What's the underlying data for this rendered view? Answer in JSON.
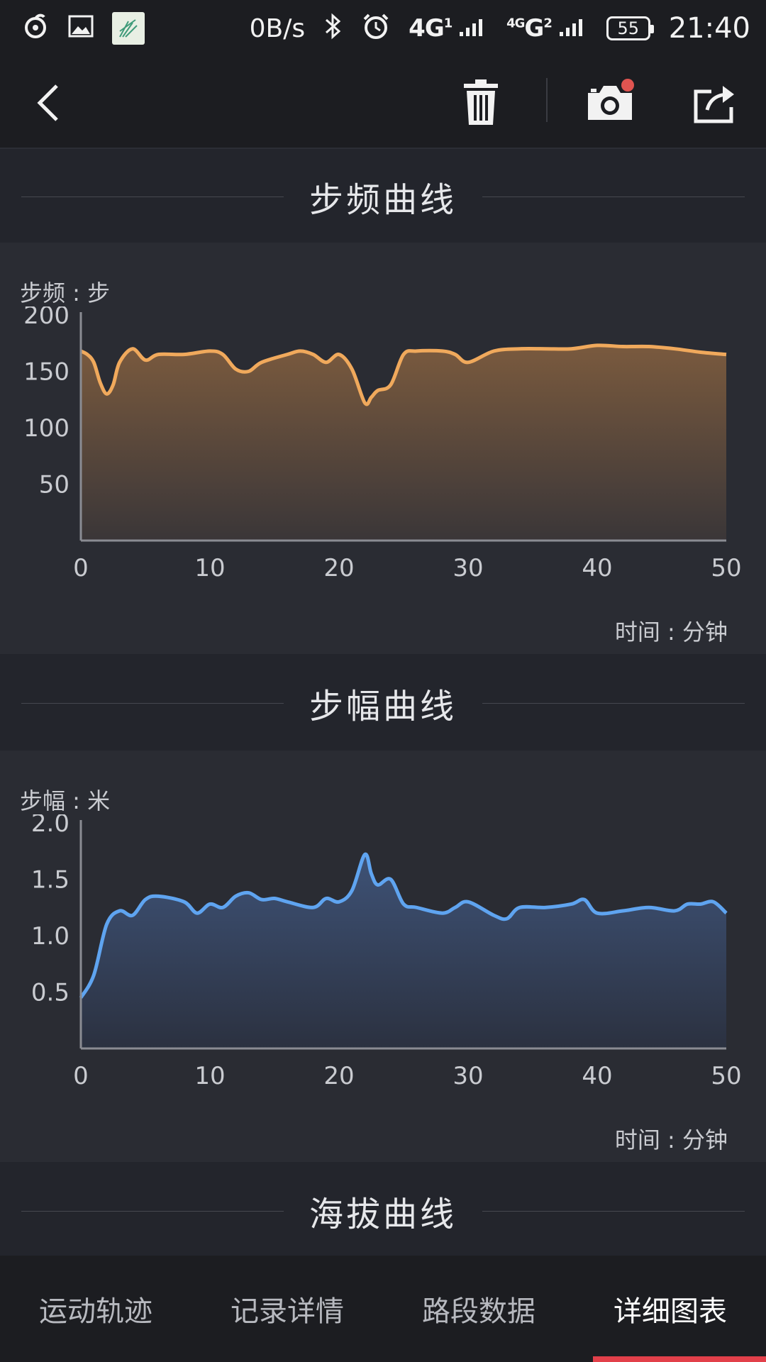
{
  "status_bar": {
    "net_speed": "0B/s",
    "signal1": "4G",
    "signal2": "4G",
    "signal2_letter": "G",
    "sim1": "1",
    "sim2": "2",
    "battery": "55",
    "time": "21:40"
  },
  "toolbar": {
    "back": "back-icon",
    "delete": "trash-icon",
    "camera": "camera-icon",
    "share": "share-icon"
  },
  "sections": {
    "cadence_title": "步频曲线",
    "stride_title": "步幅曲线",
    "altitude_title": "海拔曲线"
  },
  "cadence": {
    "y_unit": "步频 : 步",
    "x_unit": "时间 : 分钟",
    "chart_data": {
      "type": "area",
      "x": [
        0,
        0.5,
        1,
        1.5,
        2,
        2.5,
        3,
        4,
        5,
        6,
        8,
        10,
        11,
        12,
        13,
        14,
        16,
        17,
        18,
        19,
        20,
        21,
        22,
        22.5,
        23,
        24,
        25,
        26,
        28,
        29,
        30,
        32,
        34,
        36,
        38,
        40,
        42,
        44,
        46,
        48,
        50
      ],
      "values": [
        168,
        165,
        158,
        140,
        130,
        138,
        158,
        170,
        160,
        165,
        165,
        168,
        165,
        152,
        150,
        158,
        165,
        168,
        165,
        158,
        165,
        152,
        122,
        127,
        133,
        138,
        165,
        168,
        168,
        165,
        158,
        168,
        170,
        170,
        170,
        173,
        172,
        172,
        170,
        167,
        165
      ],
      "y_ticks": [
        200,
        150,
        100,
        50
      ],
      "x_ticks": [
        0,
        10,
        20,
        30,
        40,
        50
      ],
      "ylim": [
        0,
        200
      ],
      "xlim": [
        0,
        50
      ],
      "color": "#f0a95c"
    }
  },
  "stride": {
    "y_unit": "步幅 : 米",
    "x_unit": "时间 : 分钟",
    "chart_data": {
      "type": "area",
      "x": [
        0,
        1,
        2,
        3,
        4,
        5,
        6,
        8,
        9,
        10,
        11,
        12,
        13,
        14,
        15,
        16,
        18,
        19,
        20,
        21,
        22,
        22.5,
        23,
        24,
        25,
        26,
        28,
        29,
        30,
        32,
        33,
        34,
        36,
        38,
        39,
        40,
        42,
        44,
        46,
        47,
        48,
        49,
        50
      ],
      "values": [
        0.45,
        0.65,
        1.1,
        1.22,
        1.18,
        1.32,
        1.35,
        1.3,
        1.2,
        1.28,
        1.25,
        1.35,
        1.38,
        1.32,
        1.33,
        1.3,
        1.25,
        1.33,
        1.3,
        1.4,
        1.72,
        1.55,
        1.45,
        1.5,
        1.28,
        1.25,
        1.2,
        1.25,
        1.3,
        1.18,
        1.15,
        1.25,
        1.25,
        1.28,
        1.32,
        1.2,
        1.22,
        1.25,
        1.22,
        1.28,
        1.28,
        1.3,
        1.2
      ],
      "y_ticks": [
        "2.0",
        "1.5",
        "1.0",
        "0.5"
      ],
      "x_ticks": [
        0,
        10,
        20,
        30,
        40,
        50
      ],
      "ylim": [
        0,
        2
      ],
      "xlim": [
        0,
        50
      ],
      "color": "#5fa4f0"
    }
  },
  "bottom_nav": {
    "items": [
      "运动轨迹",
      "记录详情",
      "路段数据",
      "详细图表"
    ],
    "active_index": 3
  }
}
